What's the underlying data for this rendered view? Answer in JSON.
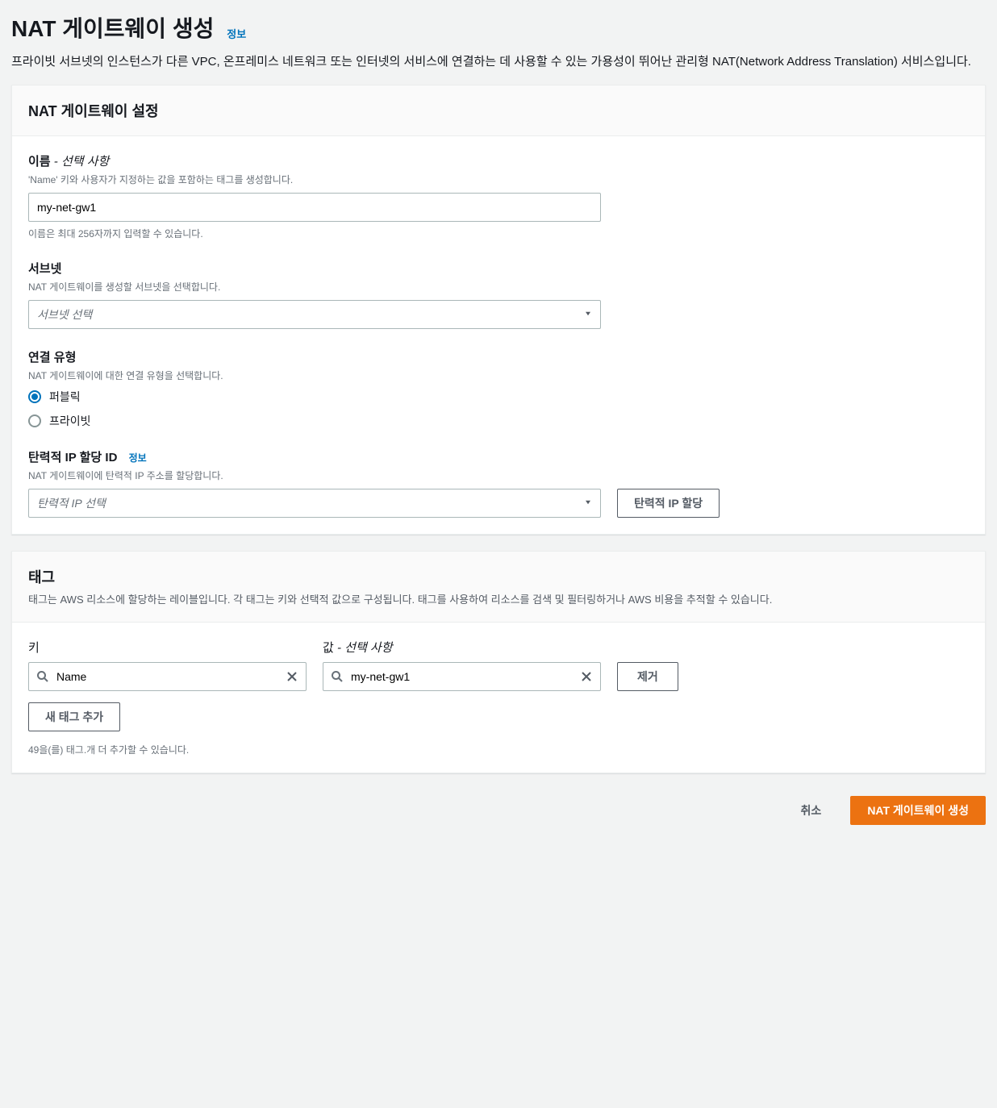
{
  "page": {
    "title": "NAT 게이트웨이 생성",
    "info_link": "정보",
    "description": "프라이빗 서브넷의 인스턴스가 다른 VPC, 온프레미스 네트워크 또는 인터넷의 서비스에 연결하는 데 사용할 수 있는 가용성이 뛰어난 관리형 NAT(Network Address Translation) 서비스입니다."
  },
  "settings": {
    "title": "NAT 게이트웨이 설정",
    "name": {
      "label": "이름",
      "optional": " - 선택 사항",
      "help": "'Name' 키와 사용자가 지정하는 값을 포함하는 태그를 생성합니다.",
      "value": "my-net-gw1",
      "hint": "이름은 최대 256자까지 입력할 수 있습니다."
    },
    "subnet": {
      "label": "서브넷",
      "help": "NAT 게이트웨이를 생성할 서브넷을 선택합니다.",
      "placeholder": "서브넷 선택"
    },
    "connection": {
      "label": "연결 유형",
      "help": "NAT 게이트웨이에 대한 연결 유형을 선택합니다.",
      "options": {
        "public": "퍼블릭",
        "private": "프라이빗"
      }
    },
    "eip": {
      "label": "탄력적 IP 할당 ID",
      "info_link": "정보",
      "help": "NAT 게이트웨이에 탄력적 IP 주소를 할당합니다.",
      "placeholder": "탄력적 IP 선택",
      "allocate_button": "탄력적 IP 할당"
    }
  },
  "tags": {
    "title": "태그",
    "description": "태그는 AWS 리소스에 할당하는 레이블입니다. 각 태그는 키와 선택적 값으로 구성됩니다. 태그를 사용하여 리소스를 검색 및 필터링하거나 AWS 비용을 추적할 수 있습니다.",
    "key_header": "키",
    "value_header": "값",
    "value_optional": " - 선택 사항",
    "row": {
      "key": "Name",
      "value": "my-net-gw1"
    },
    "remove_button": "제거",
    "add_button": "새 태그 추가",
    "remaining": "49을(를) 태그.개 더 추가할 수 있습니다."
  },
  "actions": {
    "cancel": "취소",
    "create": "NAT 게이트웨이 생성"
  }
}
